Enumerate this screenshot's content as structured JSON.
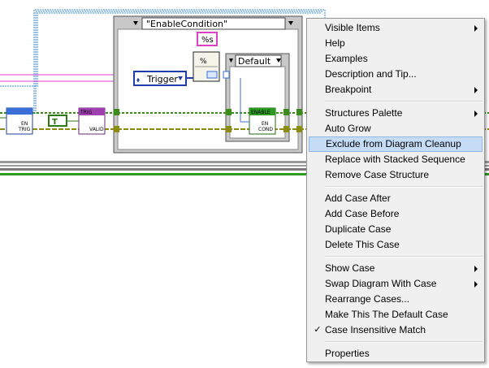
{
  "diagram": {
    "case_selector": "\"EnableCondition\"",
    "format_string": "%s",
    "trigger_enum": "Trigger",
    "inner_case_selector": "Default",
    "enable_trig_node": {
      "line1": "EN",
      "line2": "TRIG"
    },
    "trig_valid_node": {
      "header": "TRIG",
      "line1": "VALID"
    },
    "enable_cond_node": {
      "header": "ENABLE",
      "line1": "EN",
      "line2": "COND"
    },
    "bool_constant": "T"
  },
  "menu": {
    "groups": [
      [
        {
          "label": "Visible Items",
          "submenu": true
        },
        {
          "label": "Help"
        },
        {
          "label": "Examples"
        },
        {
          "label": "Description and Tip..."
        },
        {
          "label": "Breakpoint",
          "submenu": true
        }
      ],
      [
        {
          "label": "Structures Palette",
          "submenu": true
        },
        {
          "label": "Auto Grow"
        },
        {
          "label": "Exclude from Diagram Cleanup",
          "highlighted": true
        },
        {
          "label": "Replace with Stacked Sequence"
        },
        {
          "label": "Remove Case Structure"
        }
      ],
      [
        {
          "label": "Add Case After"
        },
        {
          "label": "Add Case Before"
        },
        {
          "label": "Duplicate Case"
        },
        {
          "label": "Delete This Case"
        }
      ],
      [
        {
          "label": "Show Case",
          "submenu": true
        },
        {
          "label": "Swap Diagram With Case",
          "submenu": true
        },
        {
          "label": "Rearrange Cases..."
        },
        {
          "label": "Make This The Default Case"
        },
        {
          "label": "Case Insensitive Match",
          "checked": true
        }
      ],
      [
        {
          "label": "Properties"
        }
      ]
    ]
  }
}
